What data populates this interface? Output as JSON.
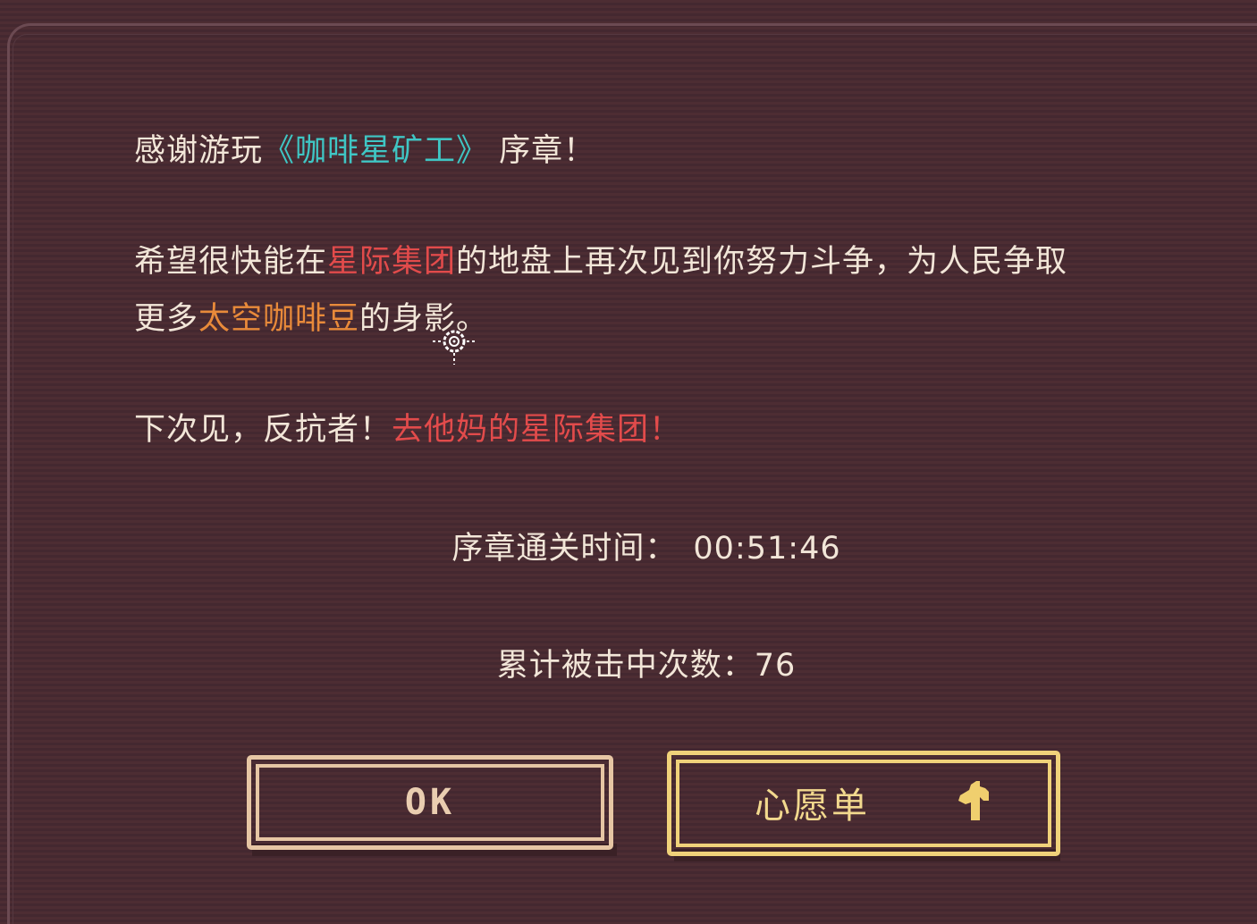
{
  "dialog": {
    "line1": {
      "prefix": "感谢游玩",
      "game_title": "《咖啡星矿工》",
      "suffix": " 序章！"
    },
    "line2": {
      "a": "希望很快能在",
      "b": "星际集团",
      "c": "的地盘上再次见到你努力斗争，为人民争取"
    },
    "line3": {
      "a": "更多",
      "b": "太空咖啡豆",
      "c": "的身影。"
    },
    "line4": {
      "a": "下次见，反抗者！",
      "b": "去他妈的星际集团！"
    },
    "stats": {
      "time_label": "序章通关时间：",
      "time_value": "00:51:46",
      "hits_label": "累计被击中次数：",
      "hits_value": "76"
    }
  },
  "buttons": {
    "ok_label": "OK",
    "wishlist_label": "心愿单"
  },
  "colors": {
    "cyan": "#3fc6c4",
    "red": "#e24b4b",
    "orange": "#e88a3a",
    "text": "#f2e6d8"
  }
}
